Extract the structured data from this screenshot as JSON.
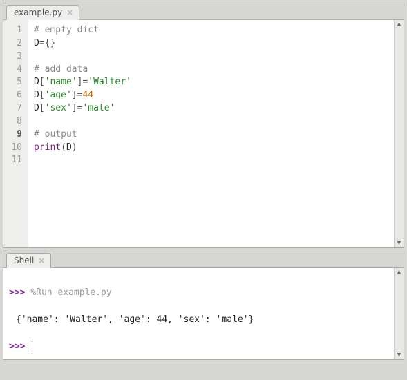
{
  "editor": {
    "tab_label": "example.py",
    "active_line": 9,
    "lines": [
      {
        "n": 1,
        "segments": [
          {
            "t": "# empty dict",
            "c": "c-comment"
          }
        ]
      },
      {
        "n": 2,
        "segments": [
          {
            "t": "D",
            "c": "c-var"
          },
          {
            "t": "=",
            "c": "c-brk"
          },
          {
            "t": "{}",
            "c": "c-brk"
          }
        ]
      },
      {
        "n": 3,
        "segments": []
      },
      {
        "n": 4,
        "segments": [
          {
            "t": "# add data",
            "c": "c-comment"
          }
        ]
      },
      {
        "n": 5,
        "segments": [
          {
            "t": "D",
            "c": "c-var"
          },
          {
            "t": "[",
            "c": "c-brk"
          },
          {
            "t": "'name'",
            "c": "c-str"
          },
          {
            "t": "]",
            "c": "c-brk"
          },
          {
            "t": "=",
            "c": "c-brk"
          },
          {
            "t": "'Walter'",
            "c": "c-str"
          }
        ]
      },
      {
        "n": 6,
        "segments": [
          {
            "t": "D",
            "c": "c-var"
          },
          {
            "t": "[",
            "c": "c-brk"
          },
          {
            "t": "'age'",
            "c": "c-str"
          },
          {
            "t": "]",
            "c": "c-brk"
          },
          {
            "t": "=",
            "c": "c-brk"
          },
          {
            "t": "44",
            "c": "c-num"
          }
        ]
      },
      {
        "n": 7,
        "segments": [
          {
            "t": "D",
            "c": "c-var"
          },
          {
            "t": "[",
            "c": "c-brk"
          },
          {
            "t": "'sex'",
            "c": "c-str"
          },
          {
            "t": "]",
            "c": "c-brk"
          },
          {
            "t": "=",
            "c": "c-brk"
          },
          {
            "t": "'male'",
            "c": "c-str"
          }
        ]
      },
      {
        "n": 8,
        "segments": []
      },
      {
        "n": 9,
        "segments": [
          {
            "t": "# output",
            "c": "c-comment"
          }
        ]
      },
      {
        "n": 10,
        "segments": [
          {
            "t": "print",
            "c": "c-fn"
          },
          {
            "t": "(",
            "c": "c-brk"
          },
          {
            "t": "D",
            "c": "c-var"
          },
          {
            "t": ")",
            "c": "c-brk"
          }
        ]
      },
      {
        "n": 11,
        "segments": []
      }
    ]
  },
  "shell": {
    "tab_label": "Shell",
    "prompt": ">>>",
    "run_command": "%Run example.py",
    "output": "{'name': 'Walter', 'age': 44, 'sex': 'male'}"
  }
}
